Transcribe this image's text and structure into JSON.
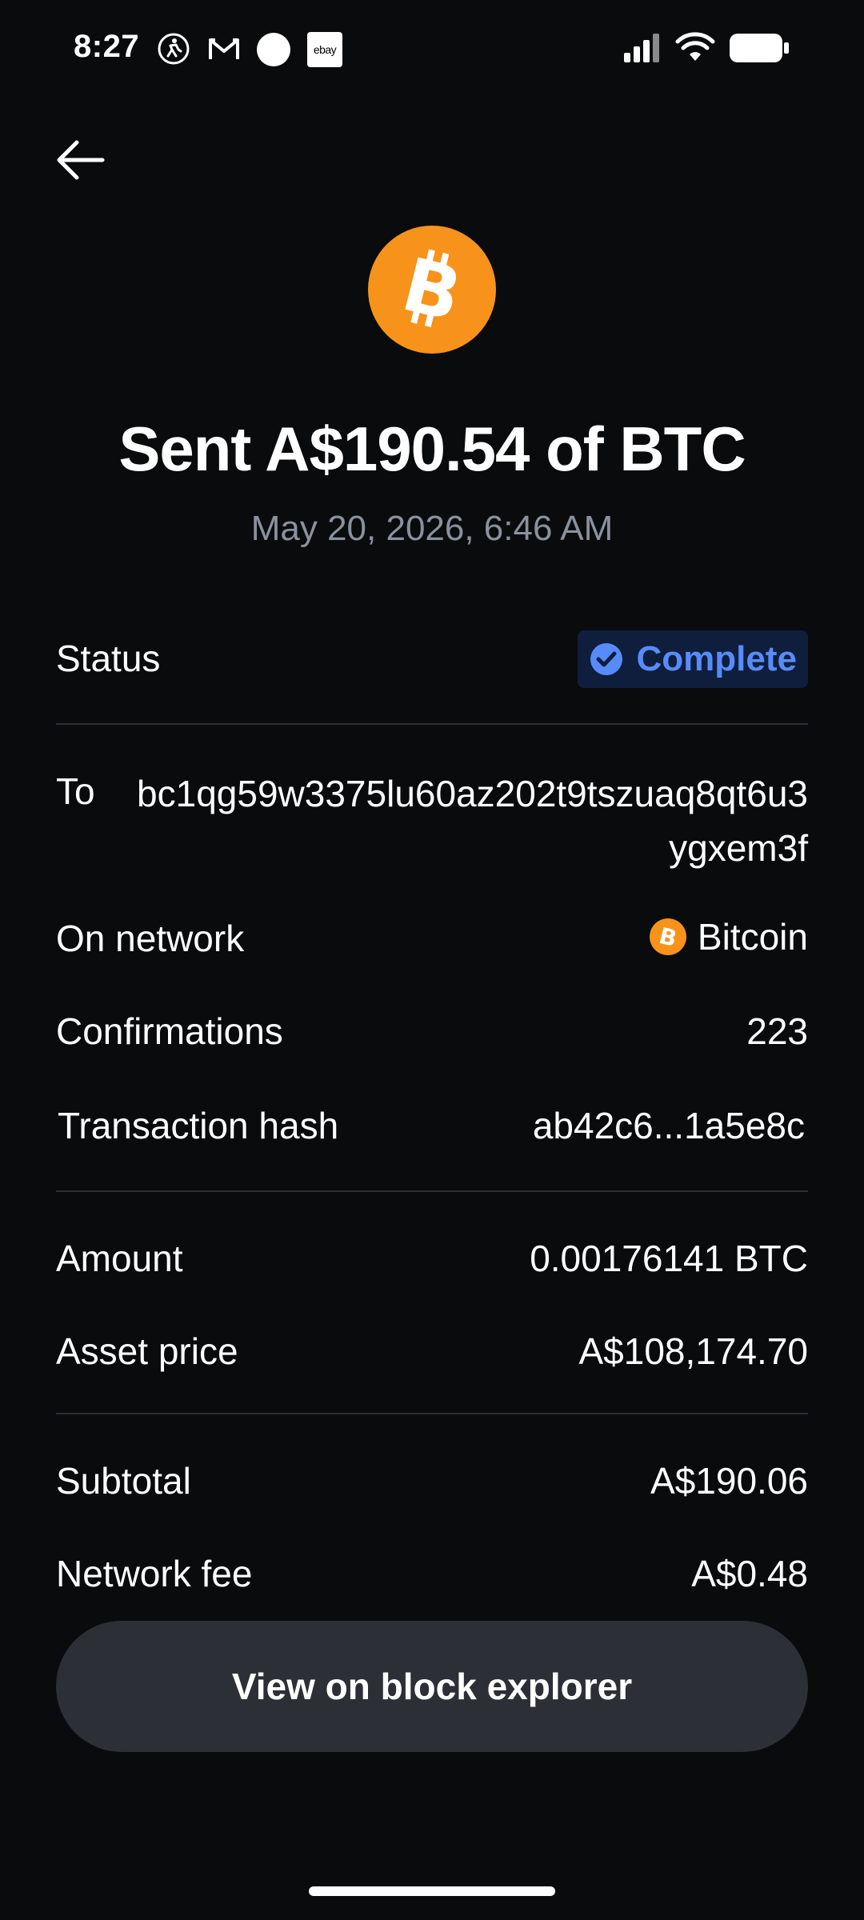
{
  "status_bar": {
    "time": "8:27",
    "left_icons": [
      "accessibility-icon",
      "gmail-icon",
      "circle-icon",
      "ebay-icon"
    ],
    "ebay_label": "ebay",
    "right_icons": [
      "signal-icon",
      "wifi-icon",
      "battery-icon"
    ]
  },
  "header": {
    "back_icon": "arrow-left-icon",
    "coin_icon": "bitcoin-icon",
    "coin_color": "#f7931a",
    "title": "Sent A$190.54 of BTC",
    "datetime": "May 20, 2026, 6:46 AM"
  },
  "details": {
    "status_label": "Status",
    "status_value": "Complete",
    "status_color": "#578bfa",
    "to_label": "To",
    "to_value": "bc1qg59w3375lu60az202t9tszuaq8qt6u3ygxem3f",
    "network_label": "On network",
    "network_value": "Bitcoin",
    "confirmations_label": "Confirmations",
    "confirmations_value": "223",
    "hash_label": "Transaction hash",
    "hash_value": "ab42c6...1a5e8c",
    "amount_label": "Amount",
    "amount_value": "0.00176141 BTC",
    "price_label": "Asset price",
    "price_value": "A$108,174.70",
    "subtotal_label": "Subtotal",
    "subtotal_value": "A$190.06",
    "fee_label": "Network fee",
    "fee_value": "A$0.48"
  },
  "actions": {
    "explorer_label": "View on block explorer"
  }
}
